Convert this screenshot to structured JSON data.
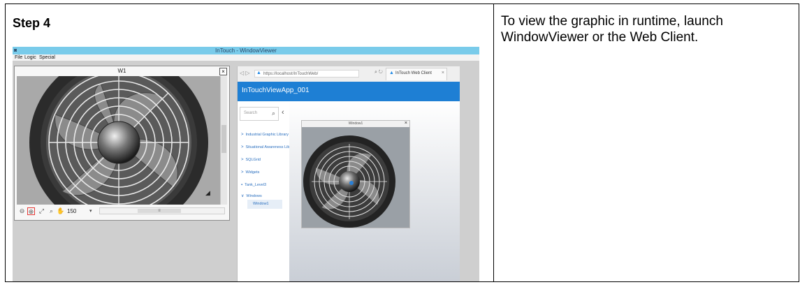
{
  "step": {
    "title": "Step 4"
  },
  "description": "To view the graphic in runtime, launch WindowViewer or the Web Client.",
  "window_viewer": {
    "title": "InTouch - WindowViewer",
    "menu": [
      "File",
      "Logic",
      "Special"
    ],
    "w1": {
      "title": "W1",
      "zoom_value": "150",
      "icons": [
        "zoom-out-icon",
        "zoom-in-icon",
        "fit-icon",
        "zoom-area-icon",
        "pan-hand-icon"
      ],
      "highlight_color": "#e53935"
    }
  },
  "web_client": {
    "url": "https://localhost/InTouchWeb/",
    "tab_title": "InTouch Web Client",
    "app_name": "InTouchViewApp_001",
    "search_placeholder": "Search",
    "nav_items": [
      {
        "label": "Industrial Graphic Library",
        "expanded": false
      },
      {
        "label": "Situational Awareness Library",
        "expanded": false
      },
      {
        "label": "SQLGrid",
        "expanded": false
      },
      {
        "label": "Widgets",
        "expanded": false
      },
      {
        "label": "Tank_Level3",
        "expanded": false
      },
      {
        "label": "Windows",
        "expanded": true
      }
    ],
    "selected_child": "Window1",
    "window_title": "Window1",
    "header_color": "#1e7fd4"
  }
}
